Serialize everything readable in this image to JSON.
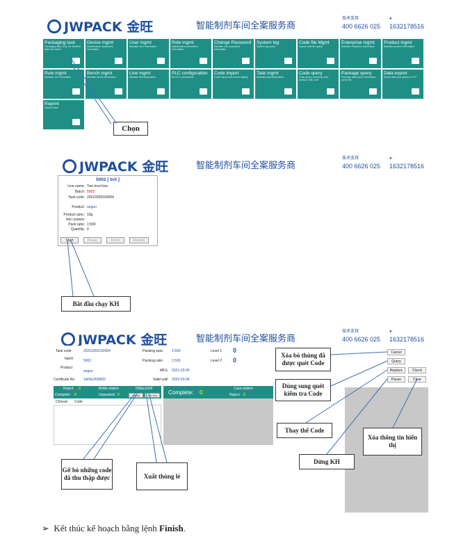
{
  "brand": {
    "name": "JWPACK",
    "name_cn": "金旺",
    "tagline": "智能制剂车间全案服务商",
    "hotline_label": "技术支持",
    "phone1": "400 6626 025",
    "phone2": "1632178516"
  },
  "tiles": [
    {
      "title": "Packaging task",
      "desc": "Packaging task, Only the finished task can export"
    },
    {
      "title": "Device mgmt",
      "desc": "Maintenance equipment information"
    },
    {
      "title": "User mgmt",
      "desc": "Maintain user information"
    },
    {
      "title": "Role mgmt",
      "desc": "Maintenance permission information"
    },
    {
      "title": "Change Password",
      "desc": "Maintain user password information"
    },
    {
      "title": "System log",
      "desc": "System log query"
    },
    {
      "title": "Code file Mgmt",
      "desc": "Import code file query"
    },
    {
      "title": "Enterprise mgmt",
      "desc": "Maintain enterprise information"
    },
    {
      "title": "Product mgmt",
      "desc": "Maintain product information"
    },
    {
      "title": "Rule mgmt",
      "desc": "Maintain rule information"
    },
    {
      "title": "Bench mgmt",
      "desc": "Maintain bench information"
    },
    {
      "title": "Line mgmt",
      "desc": "Maintain line information"
    },
    {
      "title": "PLC configuration",
      "desc": "Set PLC parameters"
    },
    {
      "title": "Code import",
      "desc": "Code import and record display"
    },
    {
      "title": "Task mgmt",
      "desc": "Maintain task information"
    },
    {
      "title": "Code query",
      "desc": "Code query, including code, product, task, unit"
    },
    {
      "title": "Package query",
      "desc": "Package data query information, query the"
    },
    {
      "title": "Data export",
      "desc": "Export data and upload to FTP"
    },
    {
      "title": "Reprint",
      "desc": "Reprint label"
    }
  ],
  "callouts": {
    "chon": "Chọn",
    "start": "Bắt đầu chạy KH",
    "cancel": "Xóa bỏ thùng đã được quét Code",
    "query": "Dùng sung quét kiểm tra Code",
    "replace": "Thay thế Code",
    "pause": "Dừng KH",
    "clear": "Xóa thông tin hiển thị",
    "remove": "Gỡ bỏ những code đã thu thập được",
    "zero": "Xuất thùng lẻ"
  },
  "task": {
    "title": "5002 [ Init ]",
    "rows": [
      {
        "k": "Line name:",
        "v": "Two level line"
      },
      {
        "k": "Batch:",
        "v": "5002"
      },
      {
        "k": "Task code:",
        "v": "20210305160004"
      },
      {
        "k": "Product:",
        "v": "angun"
      },
      {
        "k": "Product spec:",
        "v": "10g"
      },
      {
        "k": "Net content:",
        "v": ""
      },
      {
        "k": "Pack ratio:",
        "v": "1:500"
      },
      {
        "k": "Quantity:",
        "v": "0"
      }
    ],
    "buttons": [
      "Start",
      "Pause",
      "Finish",
      "Rework"
    ]
  },
  "station": {
    "task_code_k": "Task code",
    "task_code": "20210305160004",
    "batch_k": "batch",
    "batch": "5002",
    "product_k": "Product",
    "product": "angun",
    "cert_k": "Certificate No",
    "cert": "1ANGUN0002",
    "spec_k": "Packing spec",
    "spec": "1:500",
    "ratio_k": "Packing ratio",
    "ratio": "1:500",
    "mfg_k": "MFG",
    "mfg": "2021-03-05",
    "valid_k": "Valid until",
    "valid": "2023-03-04",
    "l1_k": "Level 1",
    "l1": "0",
    "l2_k": "Level 2",
    "l2": "0",
    "reject_k": "Reject:",
    "reject": "0",
    "complete_k": "Complete:",
    "complete": "0",
    "bottle_k": "Bottle station",
    "bottle": "500pcs/1th",
    "unpacked_k": "Unpacked:",
    "unpacked": "0",
    "remove_btn": "remove",
    "zero_btn": "Zero box",
    "col_choose": "Choose",
    "col_code": "Code",
    "big_complete_k": "Complete:",
    "big_complete": "0",
    "case_k": "Case station",
    "case_reject_k": "Reject:",
    "case_reject": "0",
    "side_buttons": [
      "Cancel",
      "Query",
      "Replace",
      "Check",
      "Pause",
      "Clear"
    ]
  },
  "footer": {
    "bullet": "➢",
    "text_pre": "Kết thúc kế hoạch bằng lệnh ",
    "text_bold": "Finish",
    "text_post": "."
  }
}
